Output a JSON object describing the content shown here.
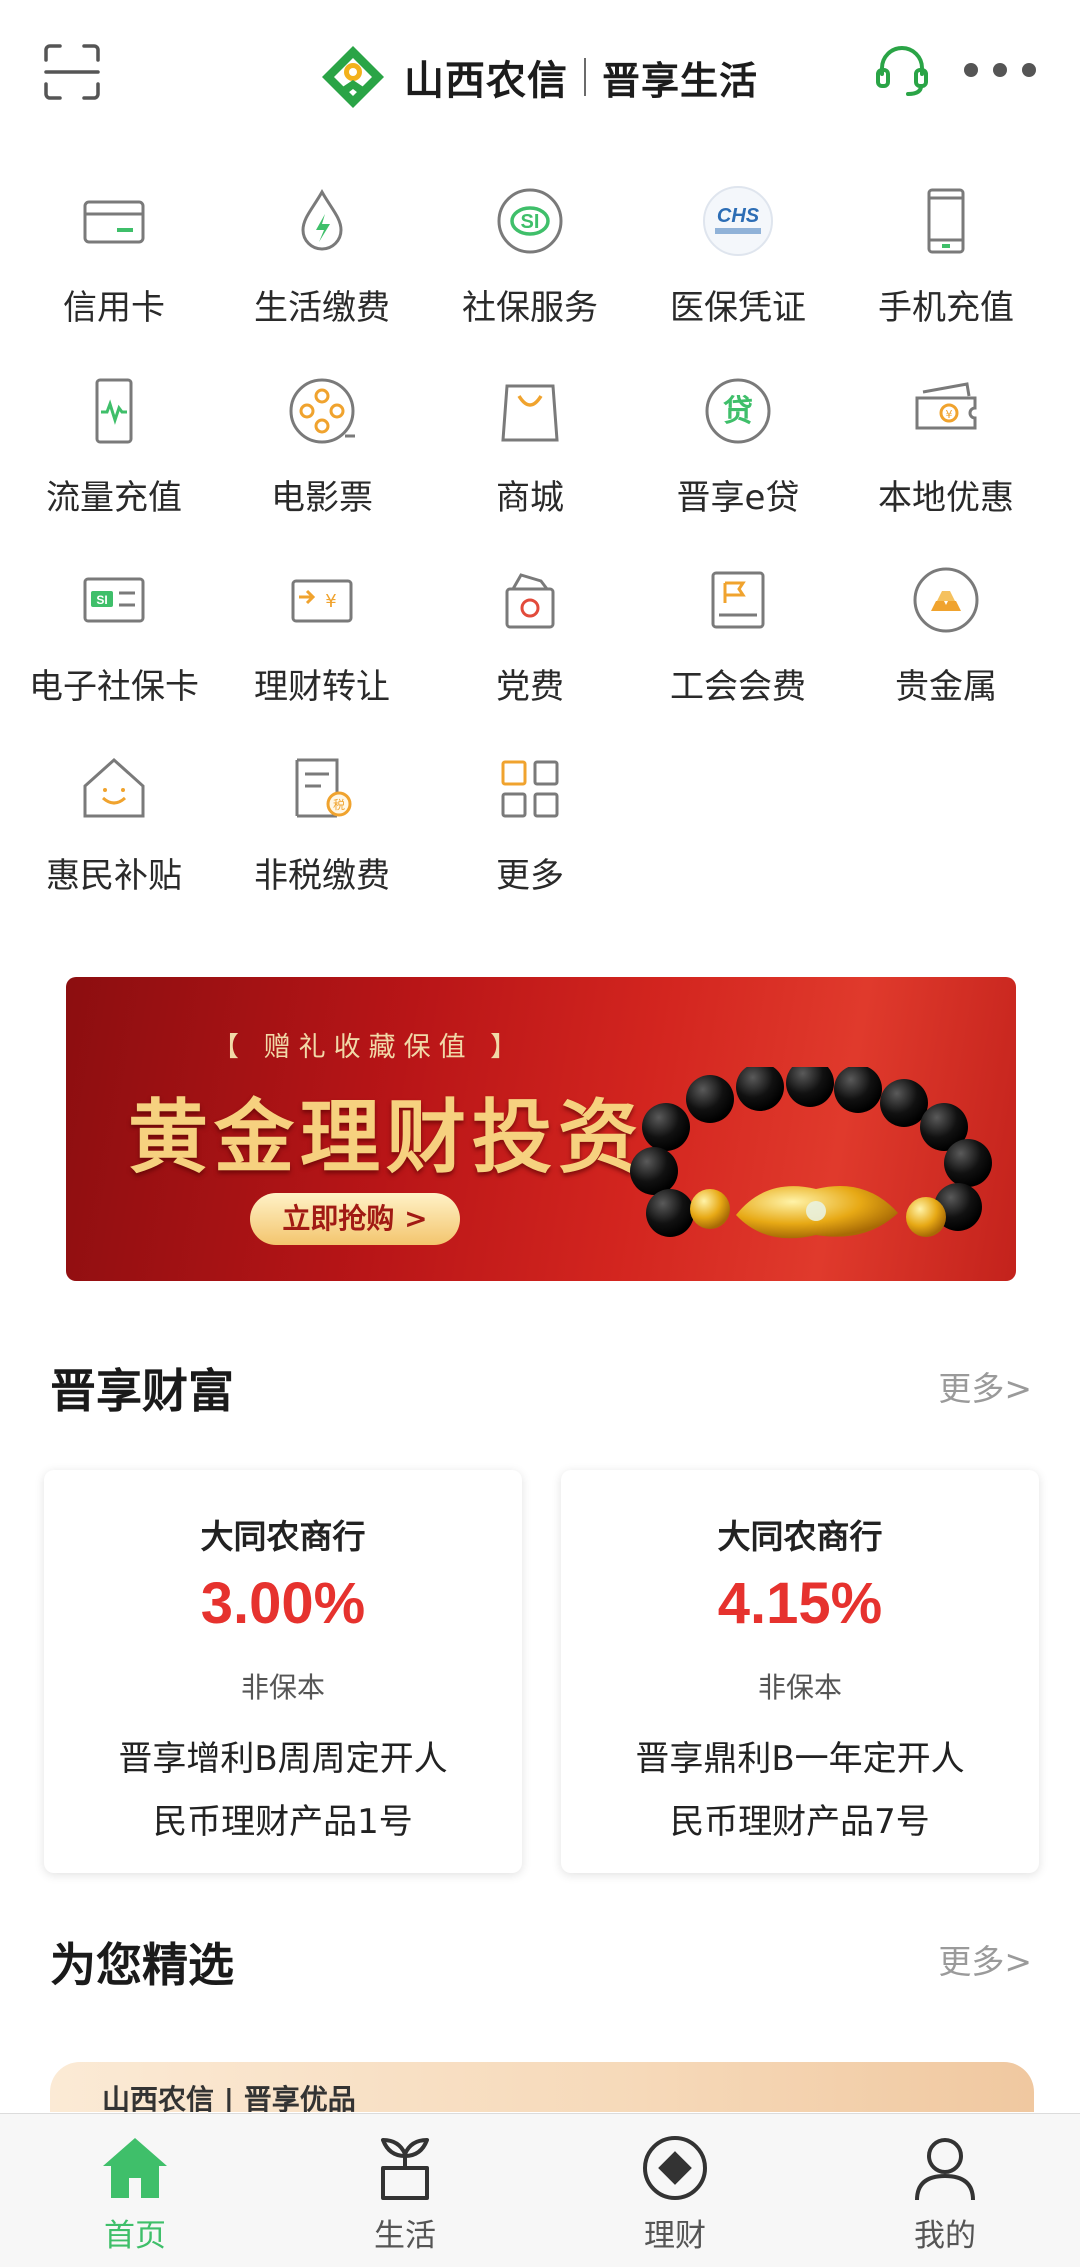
{
  "header": {
    "brand_name": "山西农信",
    "brand_sub": "晋享生活",
    "scan_icon": "scan-icon",
    "service_icon": "headset-icon",
    "more_icon": "more-dots-icon"
  },
  "services": [
    {
      "label": "信用卡",
      "icon": "credit-card-icon"
    },
    {
      "label": "生活缴费",
      "icon": "utility-drop-icon"
    },
    {
      "label": "社保服务",
      "icon": "social-security-icon"
    },
    {
      "label": "医保凭证",
      "icon": "chs-medical-insurance-icon"
    },
    {
      "label": "手机充值",
      "icon": "phone-recharge-icon"
    },
    {
      "label": "流量充值",
      "icon": "data-recharge-icon"
    },
    {
      "label": "电影票",
      "icon": "film-reel-icon"
    },
    {
      "label": "商城",
      "icon": "shopping-bag-icon"
    },
    {
      "label": "晋享e贷",
      "icon": "loan-icon"
    },
    {
      "label": "本地优惠",
      "icon": "coupon-icon"
    },
    {
      "label": "电子社保卡",
      "icon": "si-card-icon"
    },
    {
      "label": "理财转让",
      "icon": "wealth-transfer-icon"
    },
    {
      "label": "党费",
      "icon": "party-fee-icon"
    },
    {
      "label": "工会会费",
      "icon": "union-fee-icon"
    },
    {
      "label": "贵金属",
      "icon": "precious-metal-icon"
    },
    {
      "label": "惠民补贴",
      "icon": "subsidy-house-icon"
    },
    {
      "label": "非税缴费",
      "icon": "non-tax-icon"
    },
    {
      "label": "更多",
      "icon": "more-grid-icon"
    }
  ],
  "banner": {
    "tag": "【 赠礼收藏保值 】",
    "title": "黄金理财投资",
    "button": "立即抢购 >"
  },
  "wealth": {
    "title": "晋享财富",
    "more": "更多>",
    "products": [
      {
        "bank": "大同农商行",
        "rate": "3.00%",
        "risk": "非保本",
        "name_line1": "晋享增利B周周定开人",
        "name_line2": "民币理财产品1号"
      },
      {
        "bank": "大同农商行",
        "rate": "4.15%",
        "risk": "非保本",
        "name_line1": "晋享鼎利B一年定开人",
        "name_line2": "民币理财产品7号"
      }
    ]
  },
  "featured": {
    "title": "为您精选",
    "more": "更多>",
    "promo_text": "山西农信 | 晋享优品"
  },
  "bottom_nav": [
    {
      "label": "首页",
      "icon": "home-icon",
      "active": true
    },
    {
      "label": "生活",
      "icon": "sprout-pot-icon",
      "active": false
    },
    {
      "label": "理财",
      "icon": "wealth-circle-icon",
      "active": false
    },
    {
      "label": "我的",
      "icon": "user-icon",
      "active": false
    }
  ],
  "colors": {
    "brand_green": "#3fbf6a",
    "rate_red": "#e6322e",
    "banner_red": "#b81517",
    "banner_gold": "#f6d17f"
  }
}
